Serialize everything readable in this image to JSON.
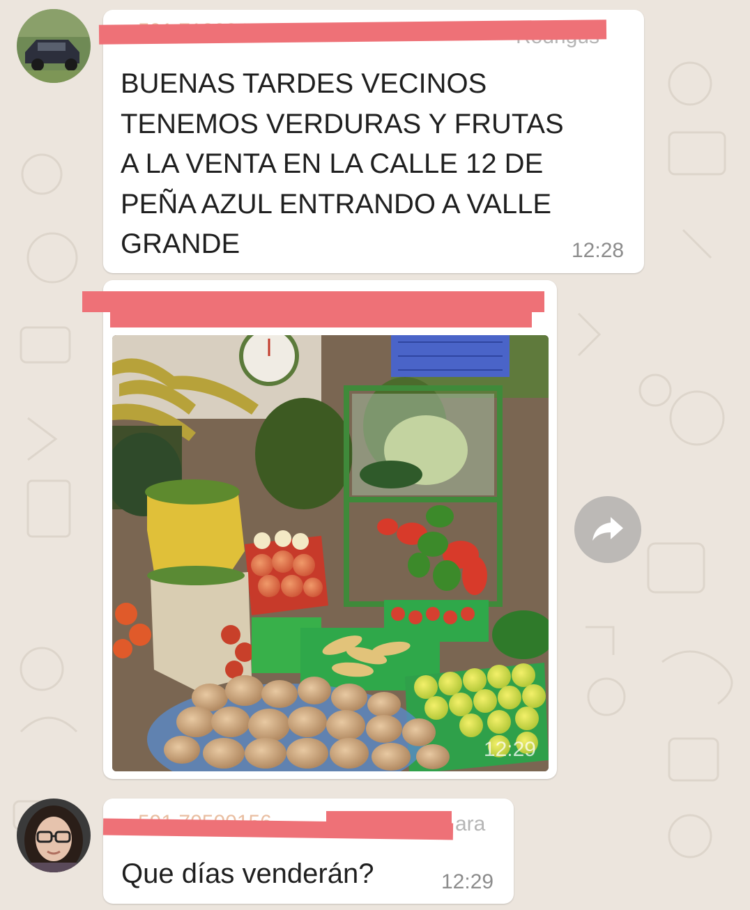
{
  "messages": [
    {
      "sender_partial": "Rodrigus",
      "text": "BUENAS TARDES VECINOS\nTENEMOS VERDURAS Y FRUTAS\nA LA VENTA EN LA CALLE 12 DE\nPEÑA AZUL ENTRANDO A  VALLE\nGRANDE",
      "time": "12:28"
    },
    {
      "image": "fruit-vegetable-stall-photo",
      "time": "12:29"
    },
    {
      "sender_partial": "ara",
      "text": "Que días venderán?",
      "time": "12:29"
    }
  ],
  "icons": {
    "forward": "forward-arrow-icon"
  },
  "colors": {
    "chat_background": "#ece5dd",
    "bubble": "#ffffff",
    "redaction": "#ee7177",
    "timestamp": "#8c8c8c"
  }
}
